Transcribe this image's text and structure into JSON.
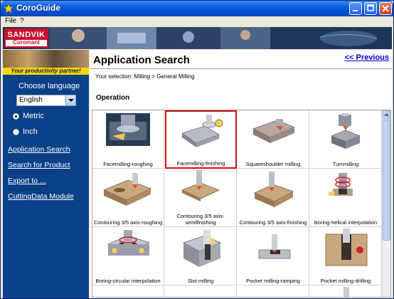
{
  "window": {
    "title": "CoroGuide"
  },
  "menu": {
    "items": [
      "File",
      "?"
    ]
  },
  "banner": {
    "brand_top": "SANDVIK",
    "brand_bottom": "Coromant"
  },
  "sidebar": {
    "tagline": "Your productivity partner!",
    "language_label": "Choose language",
    "language_value": "English",
    "units": [
      {
        "label": "Metric",
        "selected": true
      },
      {
        "label": "Inch",
        "selected": false
      }
    ],
    "links": [
      "Application Search",
      "Search for Product",
      "Export to ...",
      "CuttingData Module"
    ]
  },
  "content": {
    "title": "Application Search",
    "previous_label": "<< Previous",
    "selection": "Your selection: Milling > General Milling",
    "section": "Operation",
    "tiles": [
      {
        "label": "Facemilling-roughing",
        "icon": "facemilling-roughing-icon"
      },
      {
        "label": "Facemilling-finishing",
        "icon": "facemilling-finishing-icon",
        "selected": true
      },
      {
        "label": "Squareshoulder milling",
        "icon": "squareshoulder-icon"
      },
      {
        "label": "Turnmilling",
        "icon": "turnmilling-icon"
      },
      {
        "label": "Contouring 3/5 axis-roughing",
        "icon": "contouring-roughing-icon"
      },
      {
        "label": "Contouring 3/5 axis-semifinishing",
        "icon": "contouring-semifinishing-icon"
      },
      {
        "label": "Contouring 3/5 axis-finishing",
        "icon": "contouring-finishing-icon"
      },
      {
        "label": "Boring-helical interpolation",
        "icon": "boring-helical-icon"
      },
      {
        "label": "Boring-circular interpolation",
        "icon": "boring-circular-icon"
      },
      {
        "label": "Slot milling",
        "icon": "slot-milling-icon"
      },
      {
        "label": "Pocket milling-ramping",
        "icon": "pocket-ramping-icon"
      },
      {
        "label": "Pocket milling-drilling",
        "icon": "pocket-drilling-icon"
      }
    ]
  },
  "colors": {
    "sidebar": "#0b3f87",
    "selected_border": "#d01010",
    "link": "#0000cc",
    "tagline": "#ffd400"
  }
}
